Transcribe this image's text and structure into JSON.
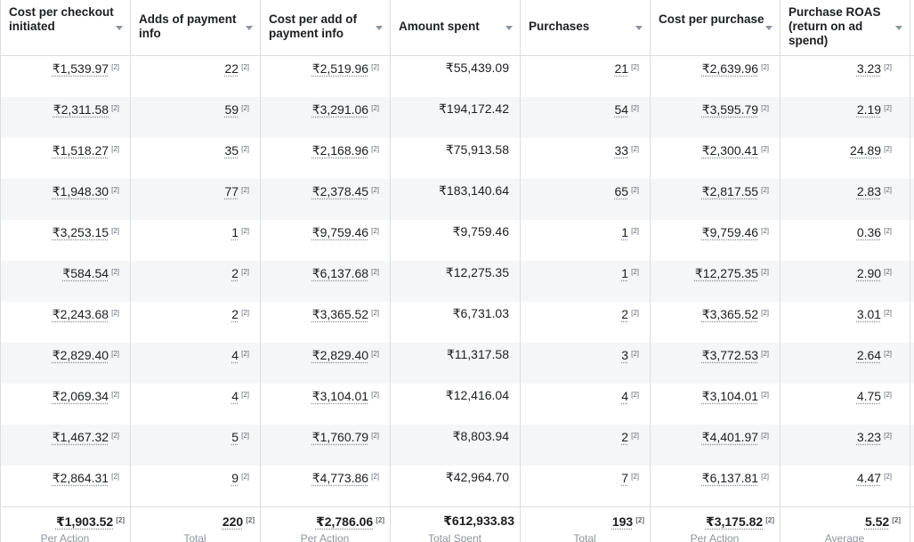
{
  "headers": [
    "Cost per checkout initiated",
    "Adds of payment info",
    "Cost per add of payment info",
    "Amount spent",
    "Purchases",
    "Cost per purchase",
    "Purchase ROAS (return on ad spend)"
  ],
  "footnote": "[2]",
  "rows": [
    [
      "₹1,539.97",
      "22",
      "₹2,519.96",
      "₹55,439.09",
      "21",
      "₹2,639.96",
      "3.23"
    ],
    [
      "₹2,311.58",
      "59",
      "₹3,291.06",
      "₹194,172.42",
      "54",
      "₹3,595.79",
      "2.19"
    ],
    [
      "₹1,518.27",
      "35",
      "₹2,168.96",
      "₹75,913.58",
      "33",
      "₹2,300.41",
      "24.89"
    ],
    [
      "₹1,948.30",
      "77",
      "₹2,378.45",
      "₹183,140.64",
      "65",
      "₹2,817.55",
      "2.83"
    ],
    [
      "₹3,253.15",
      "1",
      "₹9,759.46",
      "₹9,759.46",
      "1",
      "₹9,759.46",
      "0.36"
    ],
    [
      "₹584.54",
      "2",
      "₹6,137.68",
      "₹12,275.35",
      "1",
      "₹12,275.35",
      "2.90"
    ],
    [
      "₹2,243.68",
      "2",
      "₹3,365.52",
      "₹6,731.03",
      "2",
      "₹3,365.52",
      "3.01"
    ],
    [
      "₹2,829.40",
      "4",
      "₹2,829.40",
      "₹11,317.58",
      "3",
      "₹3,772.53",
      "2.64"
    ],
    [
      "₹2,069.34",
      "4",
      "₹3,104.01",
      "₹12,416.04",
      "4",
      "₹3,104.01",
      "4.75"
    ],
    [
      "₹1,467.32",
      "5",
      "₹1,760.79",
      "₹8,803.94",
      "2",
      "₹4,401.97",
      "3.23"
    ],
    [
      "₹2,864.31",
      "9",
      "₹4,773.86",
      "₹42,964.70",
      "7",
      "₹6,137.81",
      "4.47"
    ]
  ],
  "totals": [
    {
      "value": "₹1,903.52",
      "label": "Per Action"
    },
    {
      "value": "220",
      "label": "Total"
    },
    {
      "value": "₹2,786.06",
      "label": "Per Action"
    },
    {
      "value": "₹612,933.83",
      "label": "Total Spent"
    },
    {
      "value": "193",
      "label": "Total"
    },
    {
      "value": "₹3,175.82",
      "label": "Per Action"
    },
    {
      "value": "5.52",
      "label": "Average"
    }
  ]
}
